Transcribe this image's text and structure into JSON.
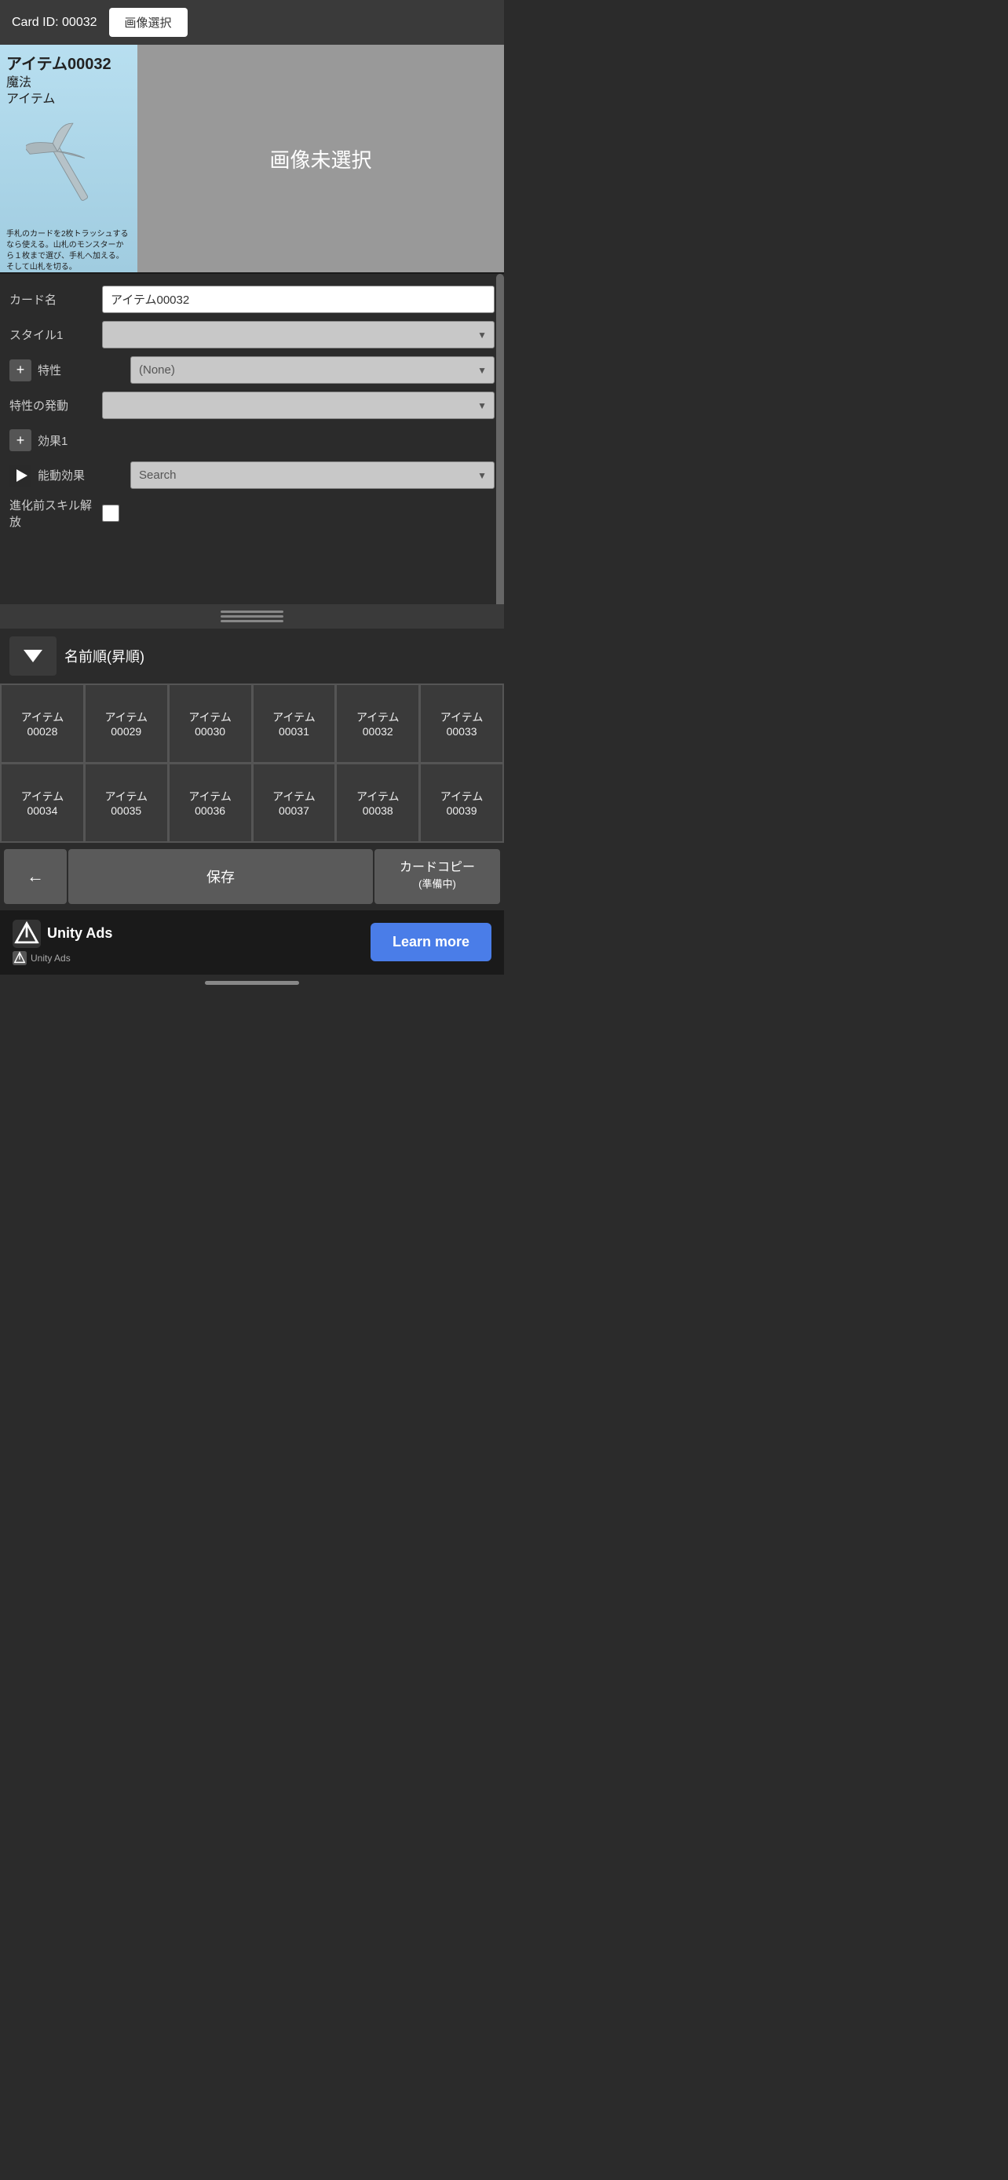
{
  "header": {
    "card_id_label": "Card ID: 00032",
    "image_select_btn": "画像選択"
  },
  "card_preview": {
    "title": "アイテム00032",
    "type1": "魔法",
    "type2": "アイテム",
    "description": "手札のカードを2枚トラッシュするなら使える。山札のモンスターから１枚まで選び、手札へ加える。そして山札を切る。",
    "no_image_text": "画像未選択"
  },
  "form": {
    "card_name_label": "カード名",
    "card_name_value": "アイテム00032",
    "style1_label": "スタイル1",
    "style1_value": "",
    "attribute_label": "特性",
    "attribute_value": "(None)",
    "attribute_trigger_label": "特性の発動",
    "attribute_trigger_value": "",
    "effect1_label": "効果1",
    "passive_effect_label": "能動効果",
    "passive_effect_value": "Search",
    "evolution_label": "進化前スキル解放"
  },
  "sort": {
    "sort_label": "名前順(昇順)"
  },
  "grid": {
    "items": [
      {
        "id": "アイテム\n00028"
      },
      {
        "id": "アイテム\n00029"
      },
      {
        "id": "アイテム\n00030"
      },
      {
        "id": "アイテム\n00031"
      },
      {
        "id": "アイテム\n00032"
      },
      {
        "id": "アイテム\n00033"
      },
      {
        "id": "アイテム\n00034"
      },
      {
        "id": "アイテム\n00035"
      },
      {
        "id": "アイテム\n00036"
      },
      {
        "id": "アイテム\n00037"
      },
      {
        "id": "アイテム\n00038"
      },
      {
        "id": "アイテム\n00039"
      }
    ]
  },
  "buttons": {
    "back_label": "←",
    "save_label": "保存",
    "copy_label": "カードコピー\n(準備中)"
  },
  "ad": {
    "unity_ads_text": "Unity Ads",
    "unity_small_text": "Unity  Ads",
    "learn_more_label": "Learn more"
  }
}
